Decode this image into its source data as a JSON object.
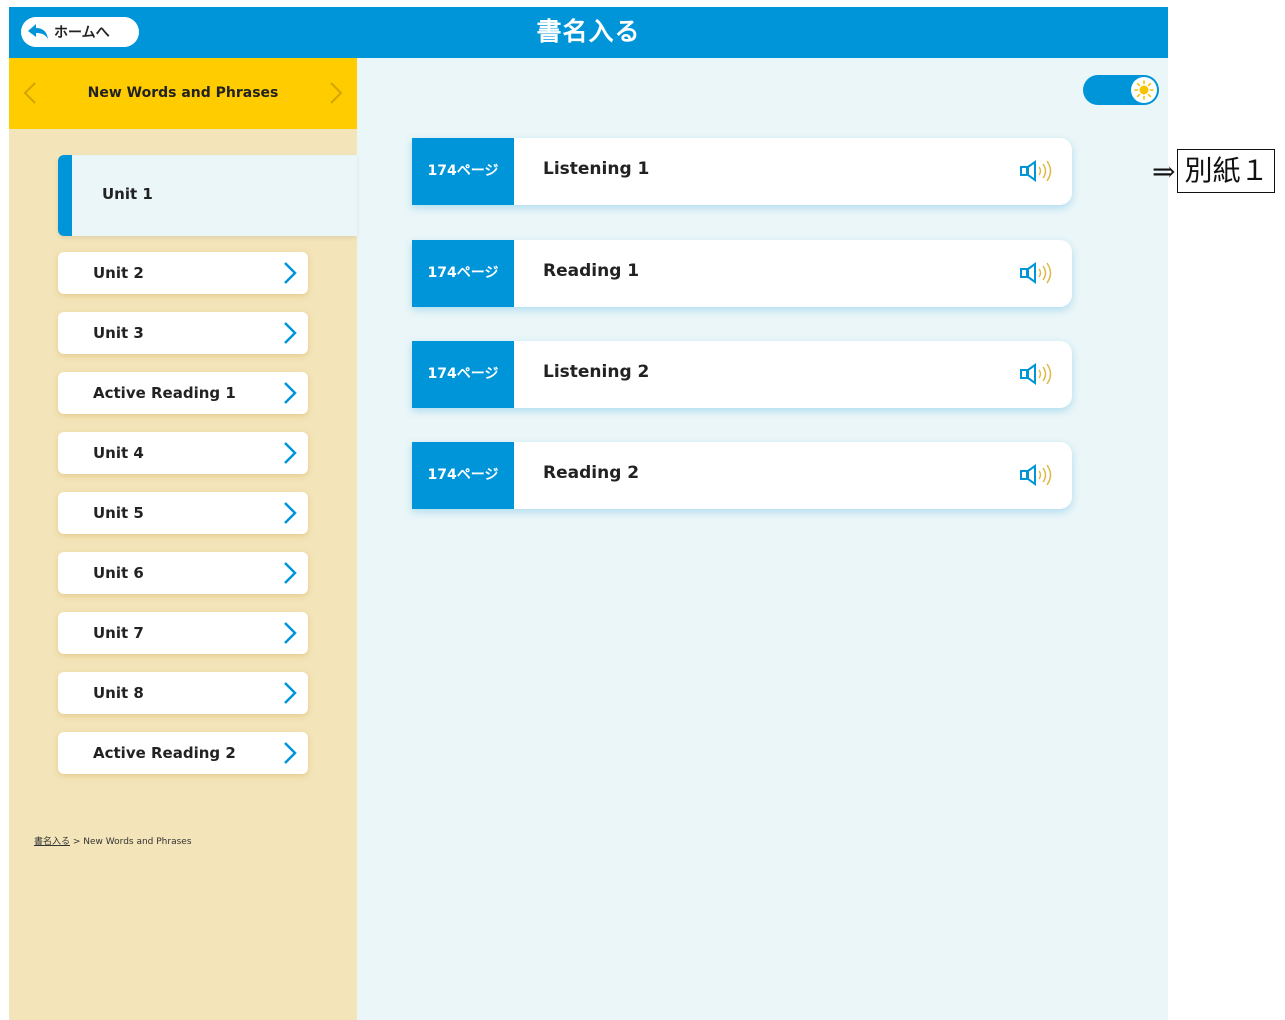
{
  "header": {
    "home_label": "ホームへ",
    "title": "書名入る"
  },
  "sidebar": {
    "section_title": "New Words and Phrases",
    "active_unit": "Unit 1",
    "items": [
      {
        "label": "Unit 2"
      },
      {
        "label": "Unit 3"
      },
      {
        "label": "Active Reading 1"
      },
      {
        "label": "Unit 4"
      },
      {
        "label": "Unit 5"
      },
      {
        "label": "Unit 6"
      },
      {
        "label": "Unit 7"
      },
      {
        "label": "Unit 8"
      },
      {
        "label": "Active Reading 2"
      }
    ],
    "breadcrumb": {
      "root": "書名入る",
      "separator": " > ",
      "current": "New Words and Phrases"
    }
  },
  "lessons": [
    {
      "page": "174ページ",
      "name": "Listening 1"
    },
    {
      "page": "174ページ",
      "name": "Reading 1"
    },
    {
      "page": "174ページ",
      "name": "Listening 2"
    },
    {
      "page": "174ページ",
      "name": "Reading 2"
    }
  ],
  "annotation": {
    "arrow": "⇒",
    "label": "別紙１"
  },
  "colors": {
    "primary_blue": "#0095d9",
    "sidebar_yellow": "#ffcc00",
    "sidebar_bg": "#f3e4b9",
    "content_bg": "#eaf6f8"
  },
  "icons": {
    "home": "back-arrow-icon",
    "prev": "chevron-left-icon",
    "next": "chevron-right-icon",
    "audio": "speaker-icon",
    "toggle": "sun-icon"
  }
}
